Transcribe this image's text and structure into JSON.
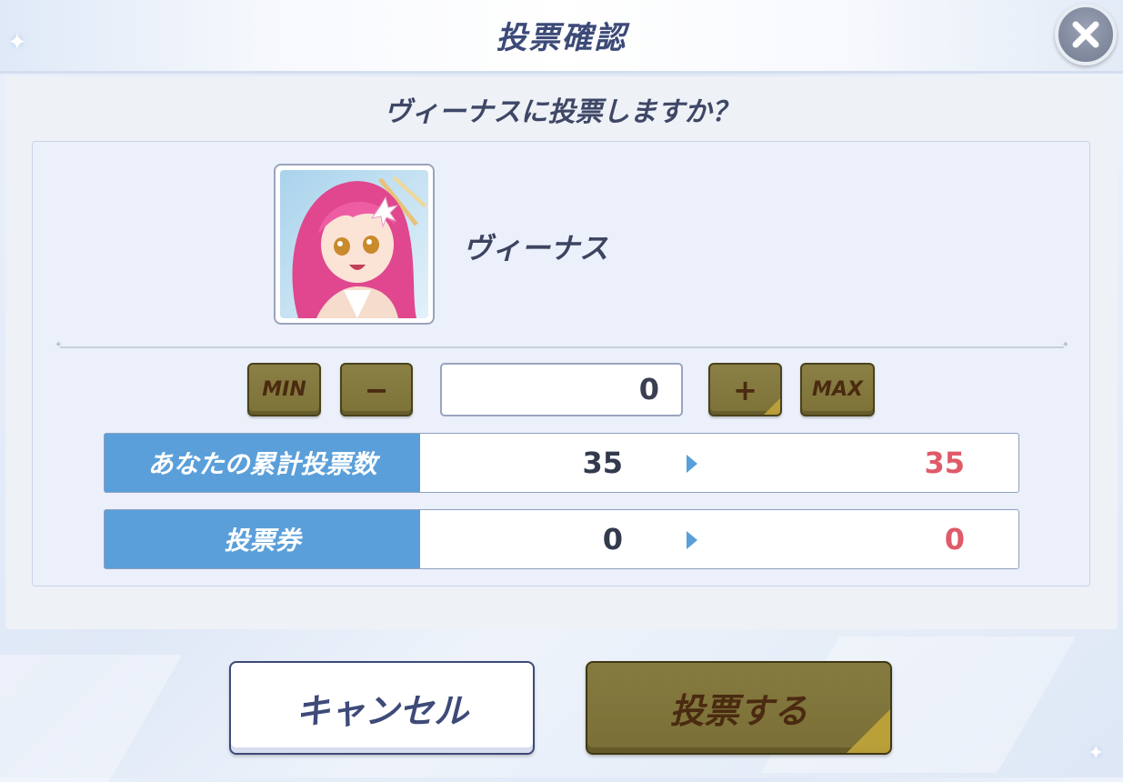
{
  "header": {
    "title": "投票確認",
    "close_icon": "close-icon"
  },
  "dialog": {
    "question": "ヴィーナスに投票しますか？"
  },
  "character": {
    "name": "ヴィーナス"
  },
  "stepper": {
    "min_label": "MIN",
    "minus_label": "−",
    "value": "0",
    "plus_label": "+",
    "max_label": "MAX"
  },
  "stats": [
    {
      "label": "あなたの累計投票数",
      "current": "35",
      "next": "35"
    },
    {
      "label": "投票券",
      "current": "0",
      "next": "0"
    }
  ],
  "actions": {
    "cancel_label": "キャンセル",
    "vote_label": "投票する"
  },
  "colors": {
    "accent_blue": "#5a9fd9",
    "olive_button": "#857a40",
    "next_value_red": "#e05a6a",
    "title_navy": "#3c4a78"
  }
}
